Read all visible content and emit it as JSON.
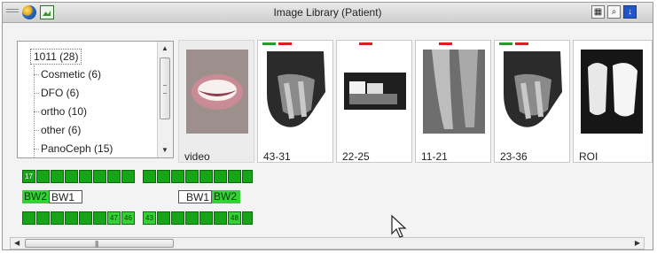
{
  "window": {
    "title": "Image Library (Patient)"
  },
  "toolbar": {
    "left_icons": [
      "globe-icon",
      "image-icon"
    ],
    "right_icons": [
      "calendar-icon",
      "zoom-icon",
      "arrow-down-icon"
    ]
  },
  "tree": {
    "root": "1011 (28)",
    "items": [
      "Cosmetic (6)",
      "DFO (6)",
      "ortho (10)",
      "other (6)",
      "PanoCeph (15)"
    ]
  },
  "thumbnails": [
    {
      "label": "video",
      "marks": []
    },
    {
      "label": "43-31",
      "marks": [
        "#2a9a2a",
        "#d82020"
      ]
    },
    {
      "label": "22-25",
      "marks": [
        "#d82020"
      ]
    },
    {
      "label": "11-21",
      "marks": [
        "#d82020"
      ]
    },
    {
      "label": "23-36",
      "marks": [
        "#2a9a2a",
        "#d82020"
      ]
    },
    {
      "label": "ROI",
      "marks": []
    }
  ],
  "bitewing": {
    "top_left_tooth": "17",
    "left_labels": [
      "BW2",
      "BW1"
    ],
    "right_labels": [
      "BW1",
      "BW2"
    ],
    "bottom_left_last": [
      "47",
      "46"
    ],
    "bottom_right_first": "43",
    "bottom_right_last": "48"
  },
  "colors": {
    "green": "#18a418",
    "light_green": "#38d038",
    "red_mark": "#d82020",
    "green_mark": "#2a9a2a"
  }
}
